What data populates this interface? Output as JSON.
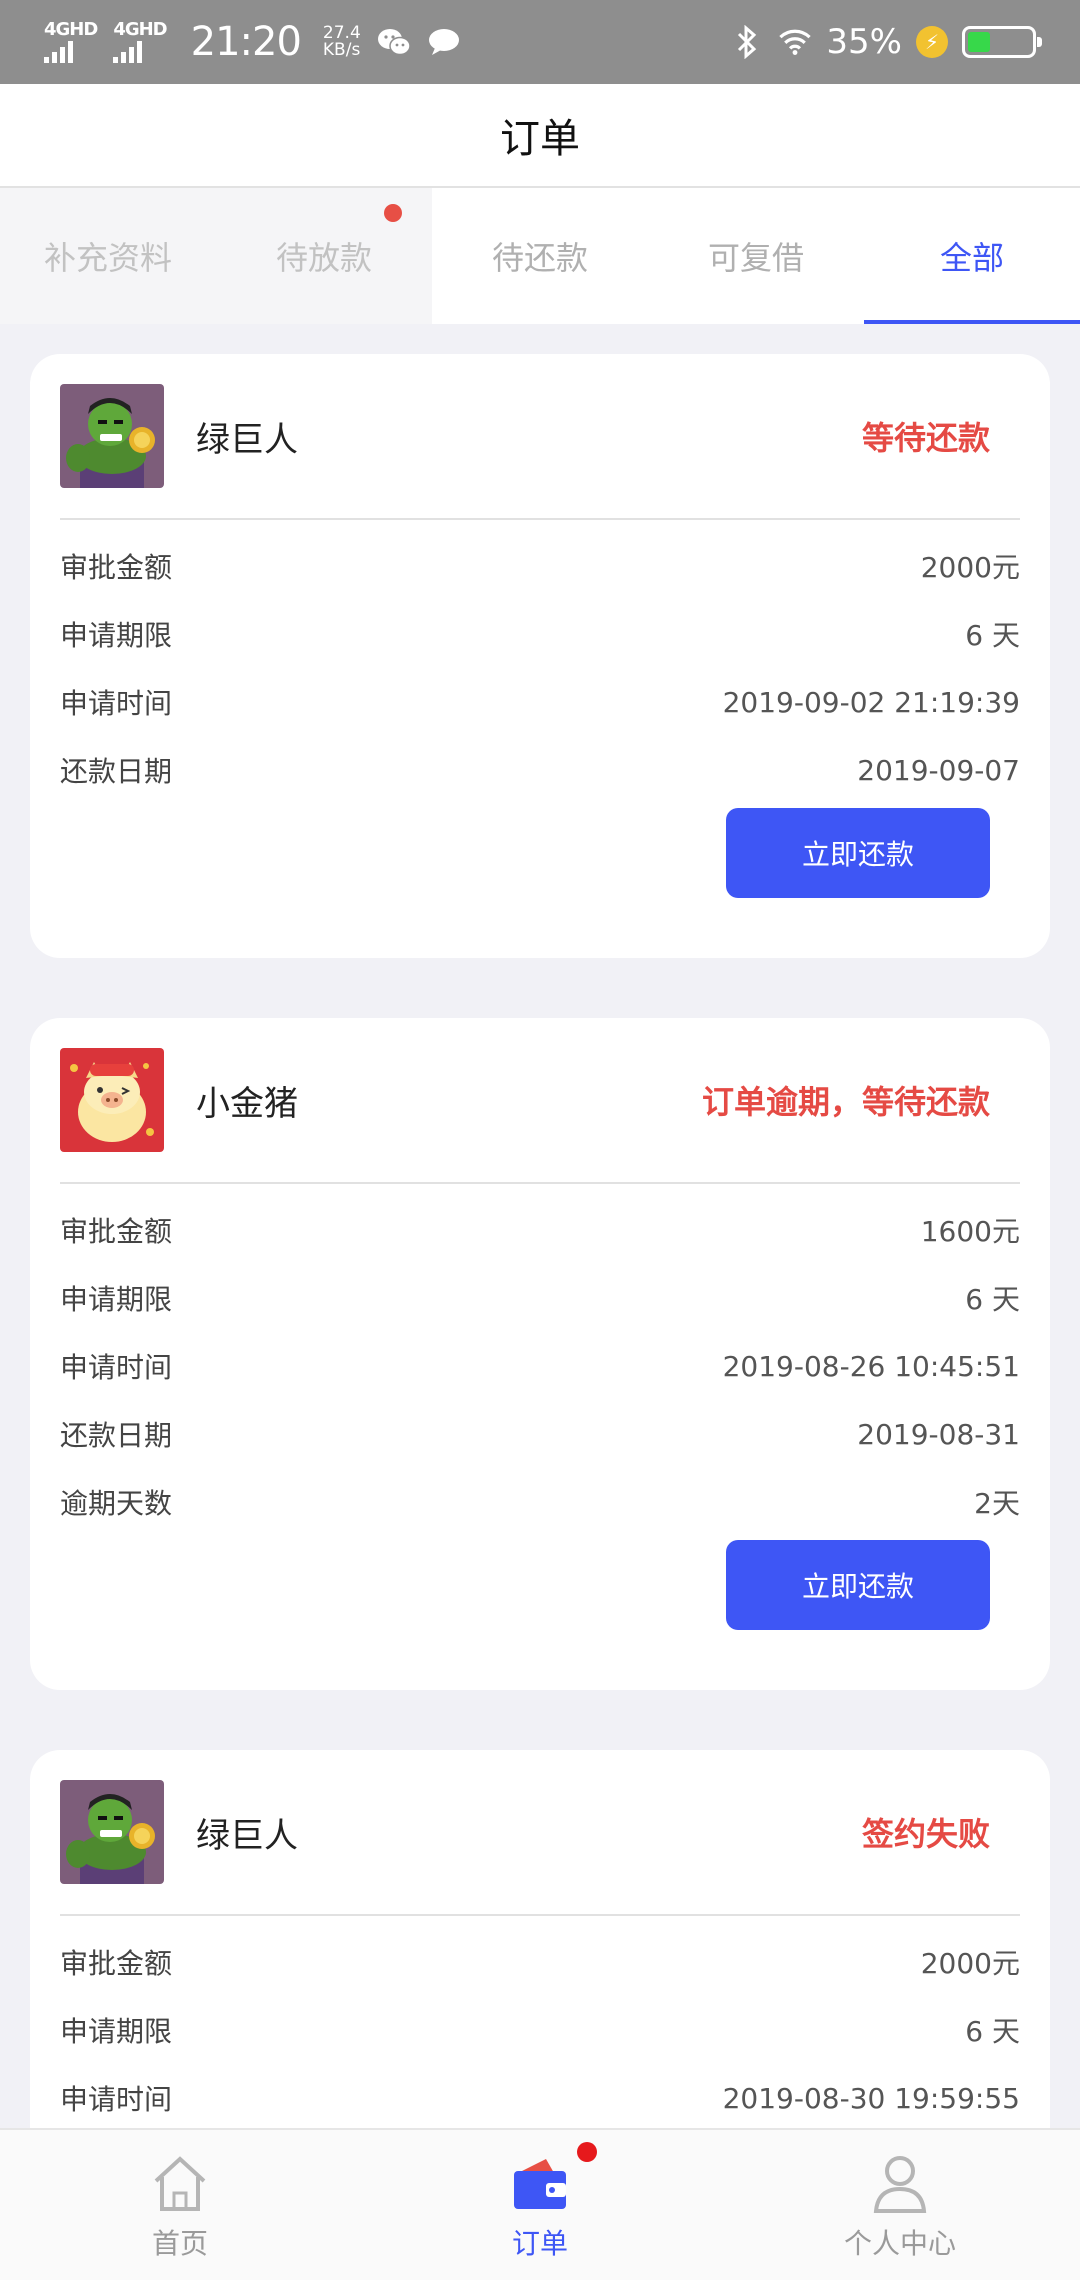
{
  "status_bar": {
    "signal_1": "4GHD",
    "signal_2": "4GHD",
    "time": "21:20",
    "speed_value": "27.4",
    "speed_unit": "KB/s",
    "battery_percent": "35%",
    "battery_level": 0.35,
    "icons": [
      "wechat-icon",
      "message-icon",
      "bluetooth-icon",
      "wifi-icon",
      "charging-icon",
      "battery-icon"
    ]
  },
  "header": {
    "title": "订单"
  },
  "tabs": [
    {
      "label": "补充资料",
      "state": "dim"
    },
    {
      "label": "待放款",
      "state": "dim",
      "has_dot": true
    },
    {
      "label": "待还款",
      "state": "normal"
    },
    {
      "label": "可复借",
      "state": "normal"
    },
    {
      "label": "全部",
      "state": "active"
    }
  ],
  "orders": [
    {
      "name": "绿巨人",
      "logo": "hulk-logo",
      "status": "等待还款",
      "rows": [
        {
          "label": "审批金额",
          "value": "2000元"
        },
        {
          "label": "申请期限",
          "value": "6 天"
        },
        {
          "label": "申请时间",
          "value": "2019-09-02 21:19:39"
        },
        {
          "label": "还款日期",
          "value": "2019-09-07"
        }
      ],
      "button": "立即还款"
    },
    {
      "name": "小金猪",
      "logo": "pig-logo",
      "status": "订单逾期，等待还款",
      "rows": [
        {
          "label": "审批金额",
          "value": "1600元"
        },
        {
          "label": "申请期限",
          "value": "6 天"
        },
        {
          "label": "申请时间",
          "value": "2019-08-26 10:45:51"
        },
        {
          "label": "还款日期",
          "value": "2019-08-31"
        },
        {
          "label": "逾期天数",
          "value": "2天"
        }
      ],
      "button": "立即还款"
    },
    {
      "name": "绿巨人",
      "logo": "hulk-logo",
      "status": "签约失败",
      "rows": [
        {
          "label": "审批金额",
          "value": "2000元"
        },
        {
          "label": "申请期限",
          "value": "6 天"
        },
        {
          "label": "申请时间",
          "value": "2019-08-30 19:59:55"
        }
      ]
    }
  ],
  "bottom_nav": [
    {
      "label": "首页",
      "icon": "home-icon",
      "active": false
    },
    {
      "label": "订单",
      "icon": "wallet-icon",
      "active": true,
      "has_dot": true
    },
    {
      "label": "个人中心",
      "icon": "person-icon",
      "active": false
    }
  ],
  "colors": {
    "accent": "#3e56f5",
    "status_red": "#e54a44",
    "background": "#f1f1f6"
  }
}
